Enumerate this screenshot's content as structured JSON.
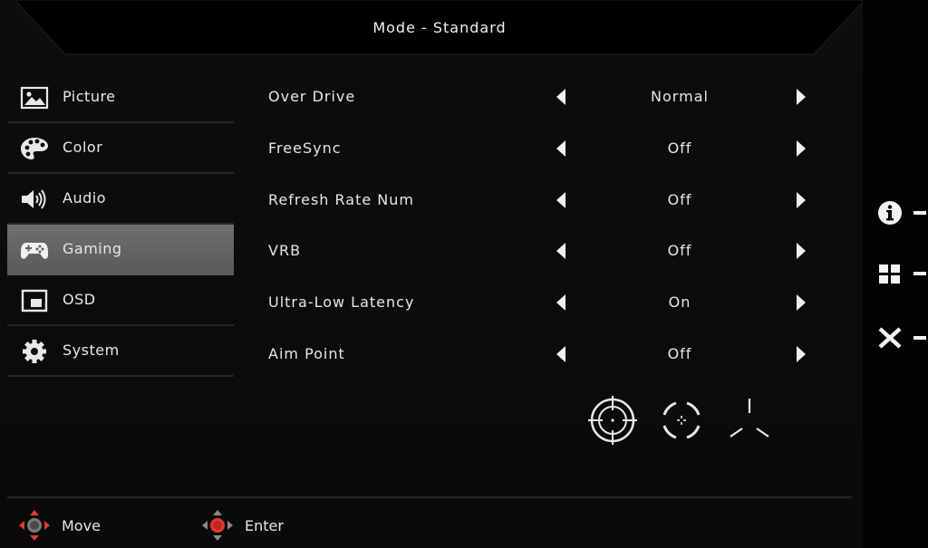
{
  "header": {
    "title": "Mode  -  Standard"
  },
  "nav": {
    "items": [
      {
        "label": "Picture",
        "icon": "picture-icon",
        "active": false
      },
      {
        "label": "Color",
        "icon": "palette-icon",
        "active": false
      },
      {
        "label": "Audio",
        "icon": "speaker-icon",
        "active": false
      },
      {
        "label": "Gaming",
        "icon": "gamepad-icon",
        "active": true
      },
      {
        "label": "OSD",
        "icon": "osd-window-icon",
        "active": false
      },
      {
        "label": "System",
        "icon": "gear-icon",
        "active": false
      }
    ]
  },
  "settings": [
    {
      "label": "Over  Drive",
      "value": "Normal"
    },
    {
      "label": "FreeSync",
      "value": "Off"
    },
    {
      "label": "Refresh  Rate  Num",
      "value": "Off"
    },
    {
      "label": "VRB",
      "value": "Off"
    },
    {
      "label": "Ultra-Low  Latency",
      "value": "On"
    },
    {
      "label": "Aim  Point",
      "value": "Off"
    }
  ],
  "aim_points": [
    {
      "icon": "crosshair-circle-icon"
    },
    {
      "icon": "crosshair-dashed-circle-icon"
    },
    {
      "icon": "crosshair-tri-icon"
    }
  ],
  "footer": {
    "move_label": "Move",
    "enter_label": "Enter"
  },
  "side_buttons": [
    {
      "icon": "info-icon"
    },
    {
      "icon": "grid-icon"
    },
    {
      "icon": "close-icon"
    }
  ],
  "colors": {
    "background": "#0a0a0a",
    "active_tab": "#646464",
    "divider": "#262626",
    "accent_red": "#e03a2e",
    "text": "#e6e6e6"
  }
}
